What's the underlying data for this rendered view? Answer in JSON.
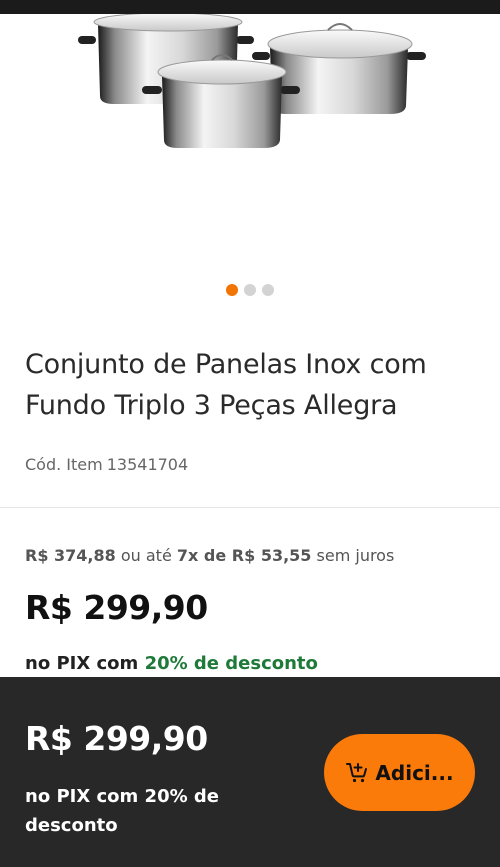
{
  "product": {
    "title": "Conjunto de Panelas Inox com Fundo Triplo 3 Peças Allegra",
    "code_label": "Cód. Item",
    "code_value": "13541704"
  },
  "gallery": {
    "total_images": 3,
    "active_index": 0,
    "accent_color": "#f27405"
  },
  "pricing": {
    "old_price": "R$ 374,88",
    "installment_text": "ou até",
    "installments": "7x de R$ 53,55",
    "installment_suffix": "sem juros",
    "price": "R$ 299,90",
    "pix_prefix": "no PIX com",
    "pix_discount": "20% de desconto"
  },
  "bottom_bar": {
    "price": "R$ 299,90",
    "pix_text": "no PIX com 20% de desconto",
    "add_button_label": "Adici...",
    "add_button_icon": "cart-add-icon",
    "button_color": "#fa7a0a"
  }
}
